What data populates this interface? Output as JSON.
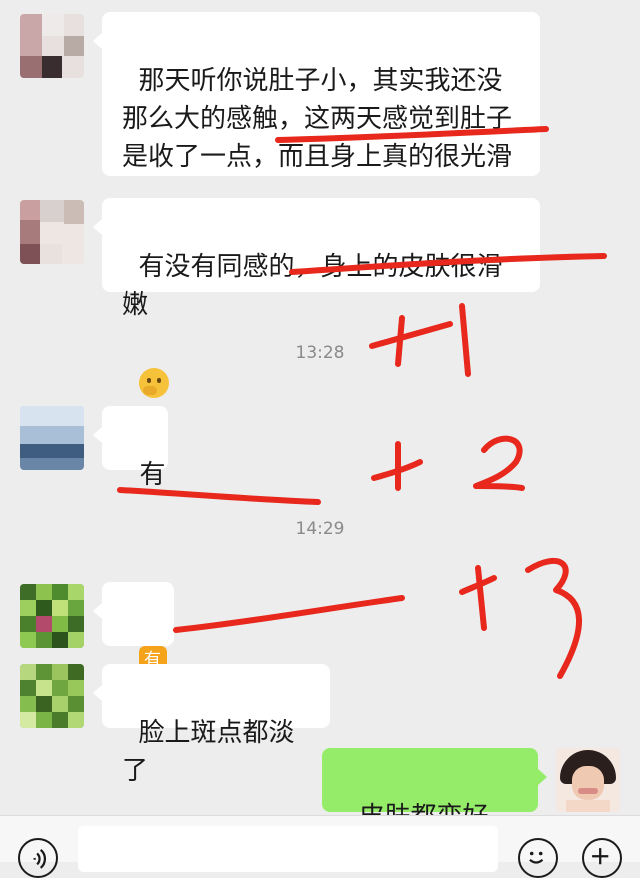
{
  "messages": [
    {
      "side": "in",
      "text": "那天听你说肚子小，其实我还没那么大的感触，这两天感觉到肚子是收了一点，而且身上真的很光滑",
      "has_emoji": true,
      "emoji": "thinking-face"
    },
    {
      "side": "in",
      "text": "有没有同感的，身上的皮肤很滑嫩",
      "has_emoji": true,
      "emoji": "thinking-face"
    },
    {
      "time": "13:28"
    },
    {
      "side": "in",
      "text": "有"
    },
    {
      "time": "14:29"
    },
    {
      "side": "in",
      "sticker": "有"
    },
    {
      "side": "in",
      "text": "脸上斑点都淡了"
    },
    {
      "side": "out",
      "text": "皮肤都变好了？"
    }
  ],
  "annotations": {
    "plus_one": "+1",
    "plus_two": "+2",
    "plus_three": "+3",
    "color": "#e8281c"
  },
  "bubble_colors": {
    "incoming": "#ffffff",
    "outgoing": "#95ec69"
  },
  "input_bar": {
    "left_icon": "voice-icon",
    "emoji_icon": "emoji-icon",
    "plus_icon": "plus-icon"
  }
}
